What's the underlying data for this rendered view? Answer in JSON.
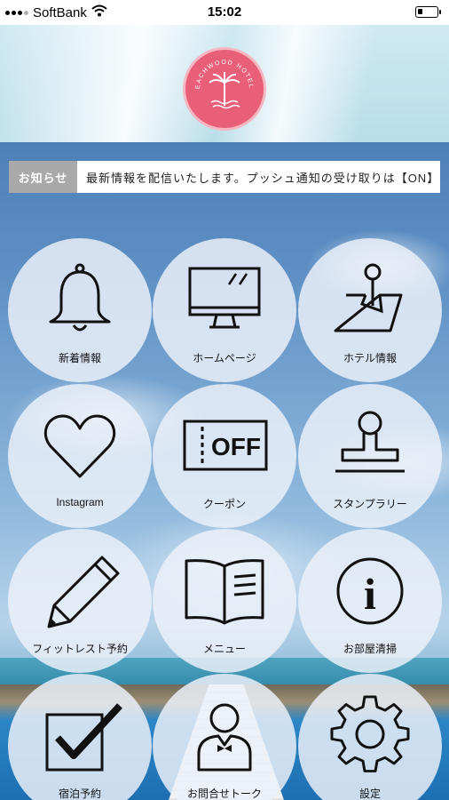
{
  "status_bar": {
    "carrier": "SoftBank",
    "time": "15:02",
    "battery_level": 0.25
  },
  "header": {
    "logo_text": "BEACHWOOD HOTELS"
  },
  "news": {
    "label": "お知らせ",
    "text": "最新情報を配信いたします。プッシュ通知の受け取りは【ON】で"
  },
  "menu": {
    "items": [
      {
        "label": "新着情報",
        "icon": "bell-icon"
      },
      {
        "label": "ホームページ",
        "icon": "monitor-icon"
      },
      {
        "label": "ホテル情報",
        "icon": "map-pin-icon"
      },
      {
        "label": "Instagram",
        "icon": "heart-icon"
      },
      {
        "label": "クーポン",
        "icon": "coupon-icon",
        "icon_text": "OFF"
      },
      {
        "label": "スタンプラリー",
        "icon": "stamp-icon"
      },
      {
        "label": "フィットレスト予約",
        "icon": "pencil-icon"
      },
      {
        "label": "メニュー",
        "icon": "book-icon"
      },
      {
        "label": "お部屋清掃",
        "icon": "info-icon",
        "icon_text": "i"
      },
      {
        "label": "宿泊予約",
        "icon": "checkbox-icon"
      },
      {
        "label": "お問合せトーク",
        "icon": "concierge-icon"
      },
      {
        "label": "設定",
        "icon": "gear-icon"
      }
    ]
  },
  "colors": {
    "logo": "#e95f78",
    "news_label_bg": "#a9a9a9",
    "tile_bg": "#ecf1f9"
  }
}
